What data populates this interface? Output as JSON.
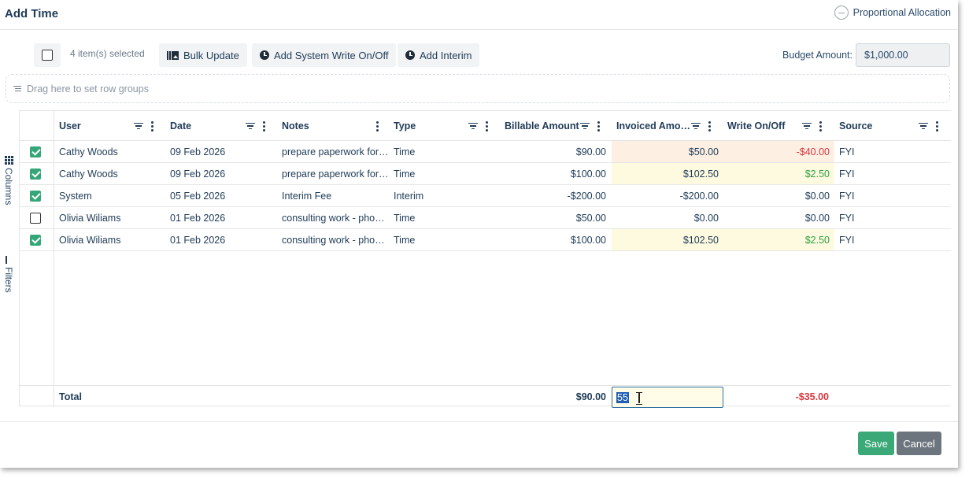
{
  "dialog": {
    "title": "Add Time",
    "proportional_allocation": "Proportional Allocation"
  },
  "toolbar": {
    "selected_count": "4 item(s) selected",
    "bulk_update": "Bulk Update",
    "add_system_write": "Add System Write On/Off",
    "add_interim": "Add Interim",
    "budget_label": "Budget Amount:",
    "budget_value": "$1,000.00"
  },
  "row_groups": {
    "placeholder": "Drag here to set row groups"
  },
  "side_panel": {
    "columns": "Columns",
    "filters": "Filters"
  },
  "columns": [
    "User",
    "Date",
    "Notes",
    "Type",
    "Billable Amount",
    "Invoiced Amo…",
    "Write On/Off",
    "Source"
  ],
  "rows": [
    {
      "checked": true,
      "user": "Cathy Woods",
      "date": "09 Feb 2026",
      "notes": "prepare paperwork for…",
      "type": "Time",
      "billable": "$90.00",
      "invoiced": "$50.00",
      "write": "-$40.00",
      "source": "FYI"
    },
    {
      "checked": true,
      "user": "Cathy Woods",
      "date": "09 Feb 2026",
      "notes": "prepare paperwork for…",
      "type": "Time",
      "billable": "$100.00",
      "invoiced": "$102.50",
      "write": "$2.50",
      "source": "FYI"
    },
    {
      "checked": true,
      "user": "System",
      "date": "05 Feb 2026",
      "notes": "Interim Fee",
      "type": "Interim",
      "billable": "-$200.00",
      "invoiced": "-$200.00",
      "write": "$0.00",
      "source": "FYI"
    },
    {
      "checked": false,
      "user": "Olivia Wiliams",
      "date": "01 Feb 2026",
      "notes": "consulting work - pho…",
      "type": "Time",
      "billable": "$50.00",
      "invoiced": "$0.00",
      "write": "$0.00",
      "source": "FYI"
    },
    {
      "checked": true,
      "user": "Olivia Wiliams",
      "date": "01 Feb 2026",
      "notes": "consulting work - pho…",
      "type": "Time",
      "billable": "$100.00",
      "invoiced": "$102.50",
      "write": "$2.50",
      "source": "FYI"
    }
  ],
  "totals": {
    "label": "Total",
    "billable": "$90.00",
    "invoiced_input": "55",
    "write": "-$35.00"
  },
  "footer": {
    "save": "Save",
    "cancel": "Cancel"
  },
  "colors": {
    "accent_green": "#3aa877",
    "negative_red": "#d9363e",
    "positive_green": "#2f9e44",
    "highlight_peach": "#fdf0e3",
    "highlight_yellow": "#fdfadf"
  }
}
